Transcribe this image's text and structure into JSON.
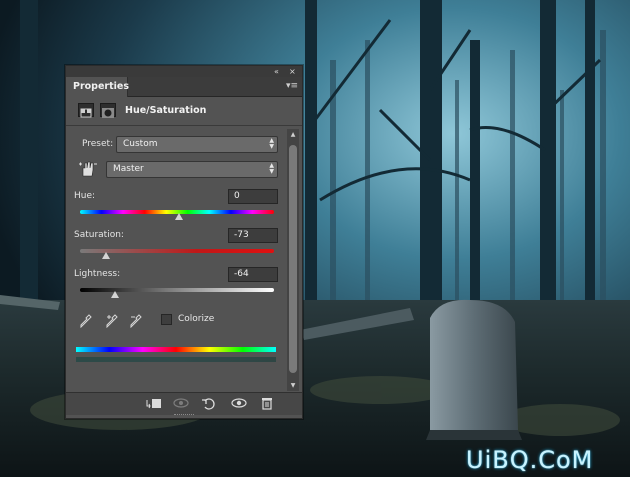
{
  "panel": {
    "tab_label": "Properties",
    "collapse_glyph": "«",
    "close_glyph": "×",
    "menu_glyph": "▾≡",
    "adjustment_title": "Hue/Saturation",
    "preset_label": "Preset:",
    "preset_value": "Custom",
    "channel_value": "Master",
    "hue": {
      "label": "Hue:",
      "value": "0",
      "slider_fraction": 0.51
    },
    "saturation": {
      "label": "Saturation:",
      "value": "-73",
      "slider_fraction": 0.135
    },
    "lightness": {
      "label": "Lightness:",
      "value": "-64",
      "slider_fraction": 0.18
    },
    "colorize_label": "Colorize",
    "colorize_checked": false,
    "icons": {
      "adjustment_layer": "adjustment-layer-icon",
      "mask": "layer-mask-icon",
      "hand": "targeted-adjustment-hand-icon",
      "eyedroppers": [
        "eyedropper-icon",
        "eyedropper-plus-icon",
        "eyedropper-minus-icon"
      ],
      "bottom": [
        "clip-to-layer-icon",
        "view-previous-state-icon",
        "reset-icon",
        "visibility-eye-icon",
        "trash-icon"
      ]
    }
  },
  "watermark": "UiBQ.CoM",
  "colors": {
    "panel_bg": "#535353",
    "accent_watermark": "#c8f3ff"
  }
}
